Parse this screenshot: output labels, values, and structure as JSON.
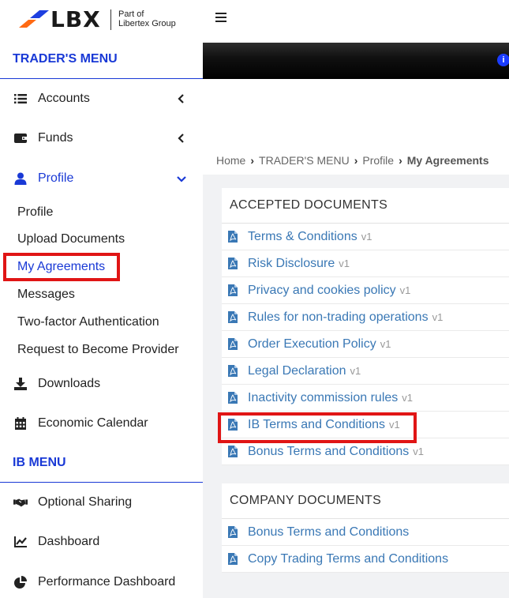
{
  "brand": {
    "name": "LBX",
    "tag_line1": "Part of",
    "tag_line2": "Libertex Group"
  },
  "sidebar": {
    "traders_menu_title": "TRADER'S MENU",
    "accounts": "Accounts",
    "funds": "Funds",
    "profile": "Profile",
    "profile_sub": {
      "profile": "Profile",
      "upload_documents": "Upload Documents",
      "my_agreements": "My Agreements",
      "messages": "Messages",
      "two_factor": "Two-factor Authentication",
      "request_provider": "Request to Become Provider"
    },
    "downloads": "Downloads",
    "economic_calendar": "Economic Calendar",
    "ib_menu_title": "IB MENU",
    "optional_sharing": "Optional Sharing",
    "dashboard": "Dashboard",
    "performance_dashboard": "Performance Dashboard"
  },
  "topbar": {
    "info_glyph": "i"
  },
  "breadcrumb": {
    "home": "Home",
    "menu": "TRADER'S MENU",
    "profile": "Profile",
    "current": "My Agreements"
  },
  "accepted": {
    "title": "ACCEPTED DOCUMENTS",
    "items": [
      {
        "name": "Terms & Conditions",
        "ver": "v1"
      },
      {
        "name": "Risk Disclosure",
        "ver": "v1"
      },
      {
        "name": "Privacy and cookies policy",
        "ver": "v1"
      },
      {
        "name": "Rules for non-trading operations",
        "ver": "v1"
      },
      {
        "name": "Order Execution Policy",
        "ver": "v1"
      },
      {
        "name": "Legal Declaration",
        "ver": "v1"
      },
      {
        "name": "Inactivity commission rules",
        "ver": "v1"
      },
      {
        "name": "IB Terms and Conditions",
        "ver": "v1"
      },
      {
        "name": "Bonus Terms and Conditions",
        "ver": "v1"
      }
    ]
  },
  "company": {
    "title": "COMPANY DOCUMENTS",
    "items": [
      {
        "name": "Bonus Terms and Conditions"
      },
      {
        "name": "Copy Trading Terms and Conditions"
      }
    ]
  },
  "colors": {
    "accent": "#1939d6",
    "link": "#3a78b5",
    "highlight": "#e01515"
  },
  "icons": {
    "accounts": "list-icon",
    "funds": "wallet-icon",
    "profile": "user-icon",
    "downloads": "download-icon",
    "calendar": "calendar-icon",
    "sharing": "handshake-icon",
    "dashboard": "line-chart-icon",
    "performance": "pie-chart-icon",
    "document": "pdf-icon"
  }
}
